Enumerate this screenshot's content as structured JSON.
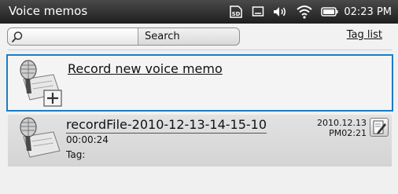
{
  "status_bar": {
    "app_title": "Voice memos",
    "clock": "02:23 PM",
    "icons": [
      "sd-card-icon",
      "screen-icon",
      "volume-icon",
      "wifi-icon",
      "battery-icon"
    ]
  },
  "search": {
    "value": "",
    "button_label": "Search",
    "icon": "search-icon"
  },
  "tag_list_label": "Tag list",
  "record_new": {
    "label": "Record new voice memo",
    "icon": "microphone-add-icon"
  },
  "memos": [
    {
      "name": "recordFile-2010-12-13-14-15-10",
      "duration": "00:00:24",
      "tag_label": "Tag:",
      "date": "2010.12.13",
      "time": "PM02:21",
      "icon": "microphone-icon",
      "edit_icon": "edit-icon"
    }
  ],
  "colors": {
    "status_bar": "#2b2b2b",
    "selection_border": "#1c7dc3",
    "background": "#f0f0f0"
  }
}
